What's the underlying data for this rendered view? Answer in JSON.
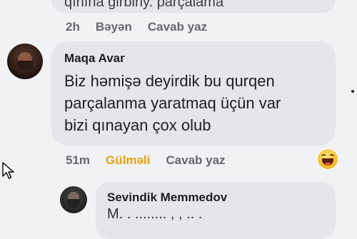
{
  "previous_comment": {
    "text_partial": "qınına girbiriy. parçalama",
    "timestamp": "2h",
    "like_label": "Bəyən",
    "reply_label": "Cavab yaz"
  },
  "comment": {
    "author": "Maqa Avar",
    "lines": [
      "Biz həmişə deyirdik bu qurqen",
      "parçalanma yaratmaq üçün var",
      "bizi qınayan çox olub"
    ],
    "timestamp": "51m",
    "reaction_label": "Gülməli",
    "reply_label": "Cavab yaz",
    "reaction_icon": "haha-emoji-icon",
    "reaction_color": "#e5a20e"
  },
  "reply": {
    "author": "Sevindik Memmedov",
    "text_partial": "M.  .  ........  ,  ,  ..  ."
  }
}
